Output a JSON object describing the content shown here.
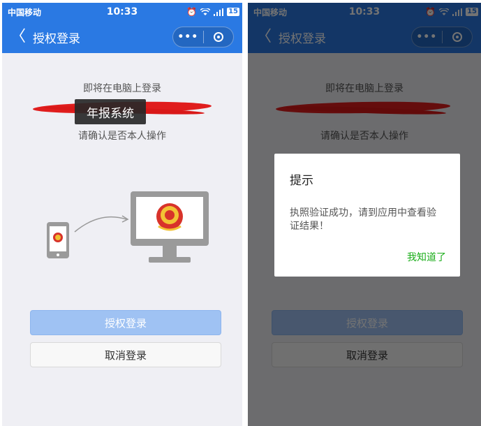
{
  "status_bar": {
    "carrier": "中国移动",
    "time": "10:33",
    "battery": "15"
  },
  "navbar": {
    "back_label": "〈",
    "title": "授权登录"
  },
  "page": {
    "message_top": "即将在电脑上登录",
    "tooltip": "年报系统",
    "message_confirm": "请确认是否本人操作",
    "authorize_button": "授权登录",
    "cancel_button": "取消登录"
  },
  "dialog": {
    "title": "提示",
    "body": "执照验证成功，请到应用中查看验证结果！",
    "confirm": "我知道了"
  },
  "colors": {
    "accent": "#2a79e3",
    "primary_button": "#9fc2f3",
    "dialog_action": "#1aad19",
    "redaction": "#e01d1d"
  },
  "icons": [
    "back-icon",
    "more-icon",
    "close-icon",
    "phone-icon",
    "computer-icon",
    "emblem-icon",
    "alarm-icon",
    "wifi-icon",
    "signal-icon"
  ]
}
